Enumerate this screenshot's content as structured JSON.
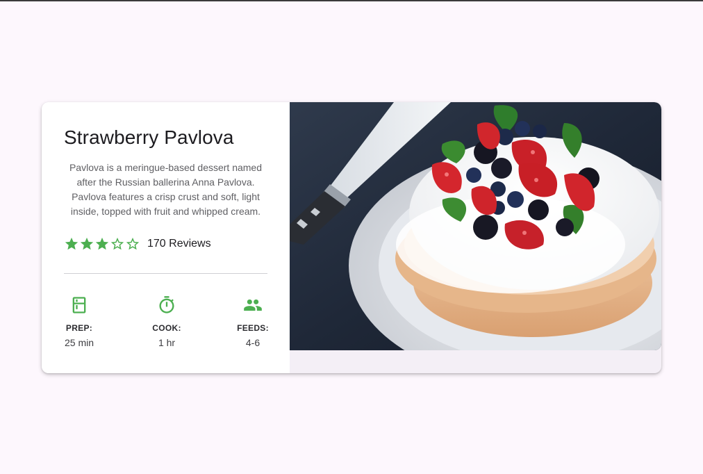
{
  "recipe": {
    "title": "Strawberry Pavlova",
    "description": "Pavlova is a meringue-based dessert named after the Russian ballerina Anna Pavlova. Pavlova features a crisp crust and soft, light inside, topped with fruit and whipped cream.",
    "rating": 3,
    "rating_max": 5,
    "reviews_label": "170 Reviews",
    "image_subject": "pavlova-cake-with-berries"
  },
  "stats": [
    {
      "icon": "kitchen-icon",
      "label": "PREP:",
      "value": "25 min"
    },
    {
      "icon": "timer-icon",
      "label": "COOK:",
      "value": "1 hr"
    },
    {
      "icon": "group-icon",
      "label": "FEEDS:",
      "value": "4-6"
    }
  ],
  "colors": {
    "accent": "#4caf50",
    "page_background": "#fdf7fd",
    "card_background": "#ffffff",
    "card_surface": "#f4eff6"
  }
}
